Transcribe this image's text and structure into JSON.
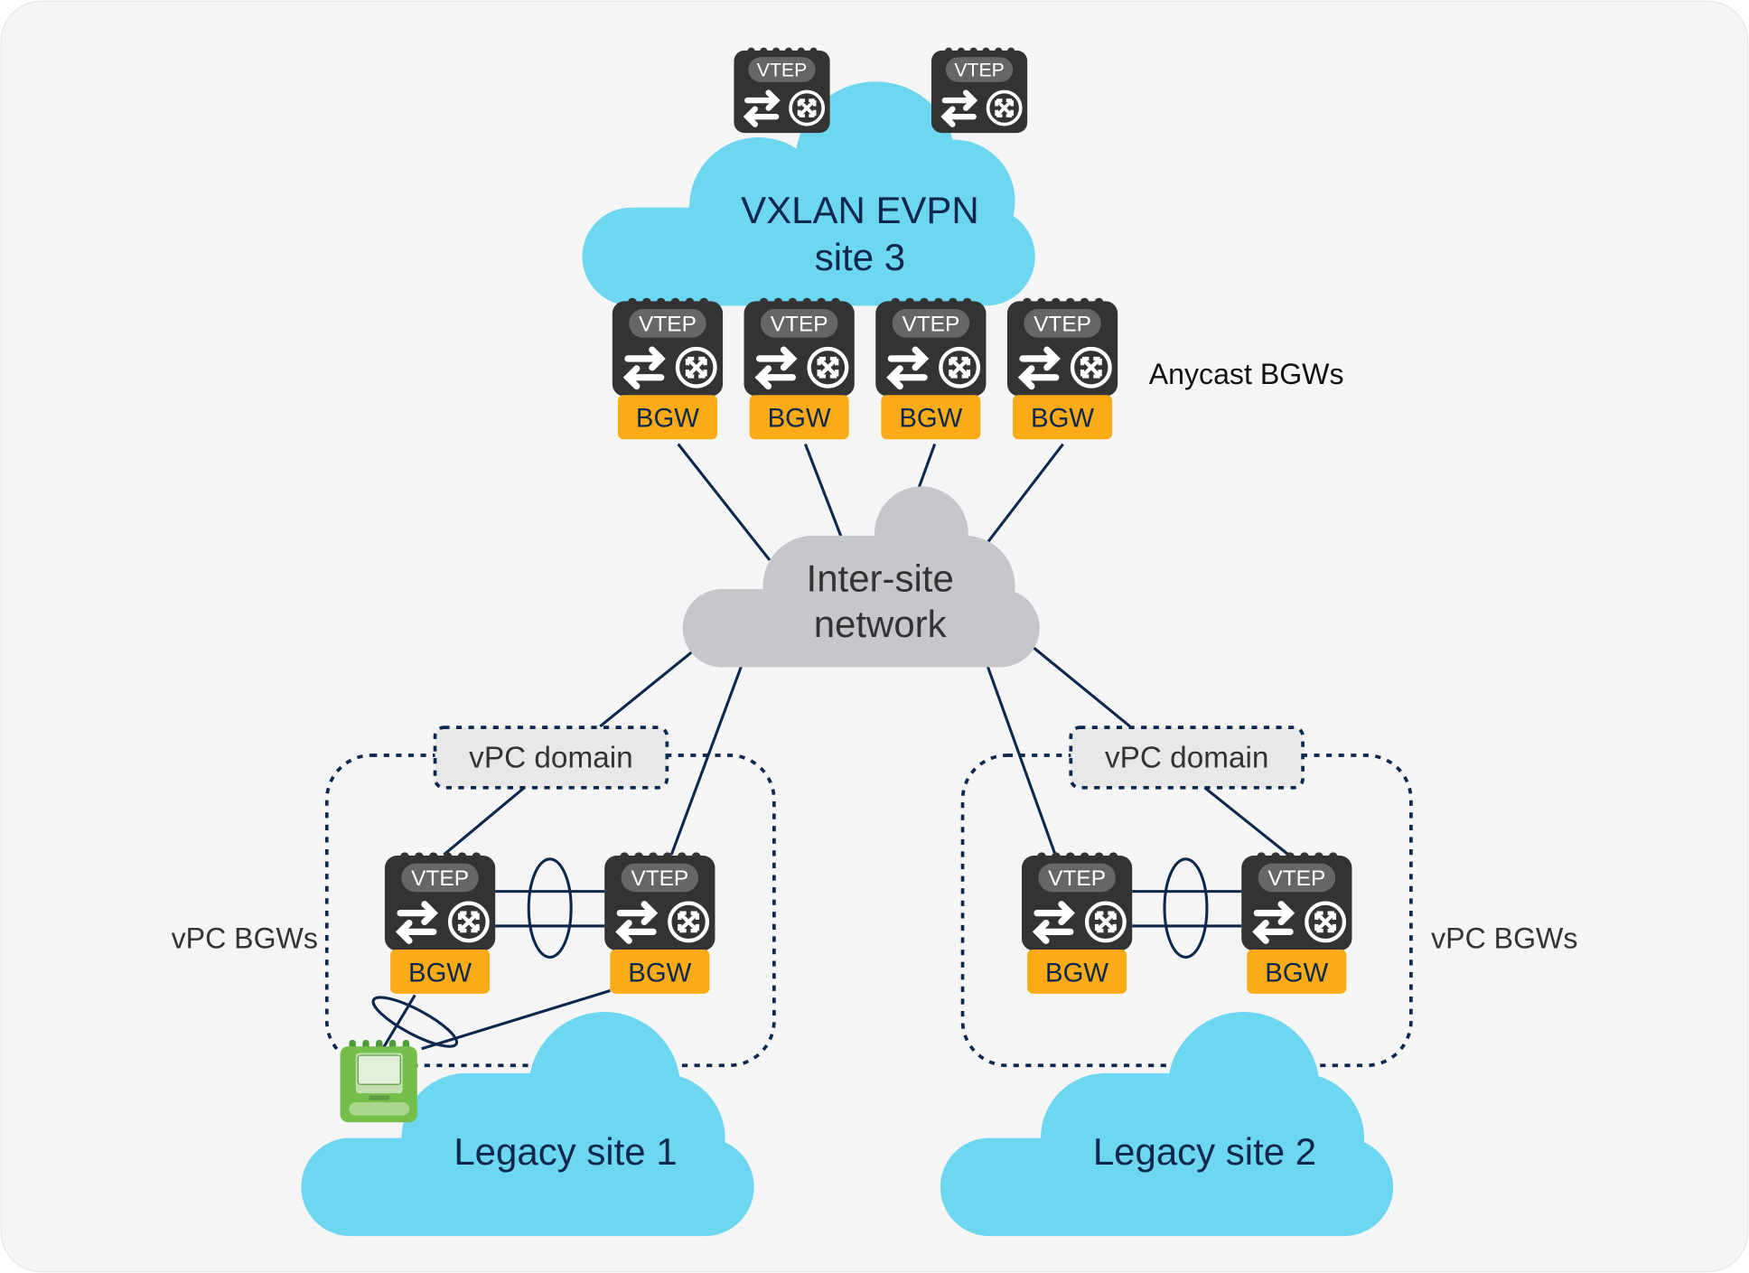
{
  "site3": {
    "line1": "VXLAN EVPN",
    "line2": "site 3"
  },
  "intersite": {
    "line1": "Inter-site",
    "line2": "network"
  },
  "anycast_label": "Anycast BGWs",
  "vpc_domain_left": "vPC domain",
  "vpc_domain_right": "vPC domain",
  "vpc_bgws_left": "vPC BGWs",
  "vpc_bgws_right": "vPC BGWs",
  "legacy1": "Legacy site 1",
  "legacy2": "Legacy site 2",
  "device_label": "VTEP",
  "bgw_label": "BGW",
  "colors": {
    "cloud_blue": "#6dd6f0",
    "cloud_gray": "#c6c7cb",
    "device": "#333333",
    "bgw": "#fbab18",
    "host": "#75be4a",
    "line": "#0d274d"
  }
}
